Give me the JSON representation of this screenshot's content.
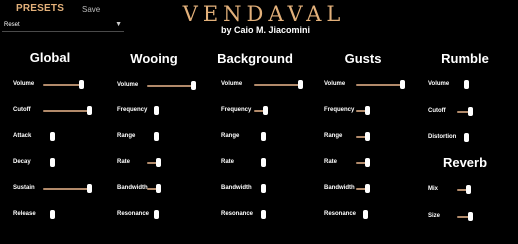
{
  "header": {
    "presets_label": "PRESETS",
    "save_label": "Save",
    "preset_value": "Reset",
    "title": "VENDAVAL",
    "subtitle": "by Caio M. Jiacomini"
  },
  "sections": [
    {
      "key": "global",
      "title": "Global",
      "params": [
        {
          "label": "Volume",
          "value": 0.78
        },
        {
          "label": "Cutoff",
          "value": 1.0
        },
        {
          "label": "Attack",
          "value": 0.0
        },
        {
          "label": "Decay",
          "value": 0.0
        },
        {
          "label": "Sustain",
          "value": 1.0
        },
        {
          "label": "Release",
          "value": 0.0
        }
      ]
    },
    {
      "key": "wooing",
      "title": "Wooing",
      "params": [
        {
          "label": "Volume",
          "value": 1.0
        },
        {
          "label": "Frequency",
          "value": 0.0
        },
        {
          "label": "Range",
          "value": 0.0
        },
        {
          "label": "Rate",
          "value": 0.05
        },
        {
          "label": "Bandwidth",
          "value": 0.05
        },
        {
          "label": "Resonance",
          "value": 0.0
        }
      ]
    },
    {
      "key": "background",
      "title": "Background",
      "params": [
        {
          "label": "Volume",
          "value": 1.0
        },
        {
          "label": "Frequency",
          "value": 0.05
        },
        {
          "label": "Range",
          "value": 0.0
        },
        {
          "label": "Rate",
          "value": 0.0
        },
        {
          "label": "Bandwidth",
          "value": 0.0
        },
        {
          "label": "Resonance",
          "value": 0.0
        }
      ]
    },
    {
      "key": "gusts",
      "title": "Gusts",
      "params": [
        {
          "label": "Volume",
          "value": 1.0
        },
        {
          "label": "Frequency",
          "value": 0.05
        },
        {
          "label": "Range",
          "value": 0.05
        },
        {
          "label": "Rate",
          "value": 0.05
        },
        {
          "label": "Bandwidth",
          "value": 0.05
        },
        {
          "label": "Resonance",
          "value": 0.0
        }
      ]
    },
    {
      "key": "rumble",
      "title": "Rumble",
      "params": [
        {
          "label": "Volume",
          "value": 0.0
        },
        {
          "label": "Cutoff",
          "value": 0.1
        },
        {
          "label": "Distortion",
          "value": 0.0
        }
      ]
    },
    {
      "key": "reverb",
      "title": "Reverb",
      "params": [
        {
          "label": "Mix",
          "value": 0.05
        },
        {
          "label": "Size",
          "value": 0.1
        }
      ]
    }
  ],
  "colors": {
    "accent": "#e2b07a",
    "track": "#b18a6a",
    "knob": "#ffffff",
    "background": "#000000"
  }
}
